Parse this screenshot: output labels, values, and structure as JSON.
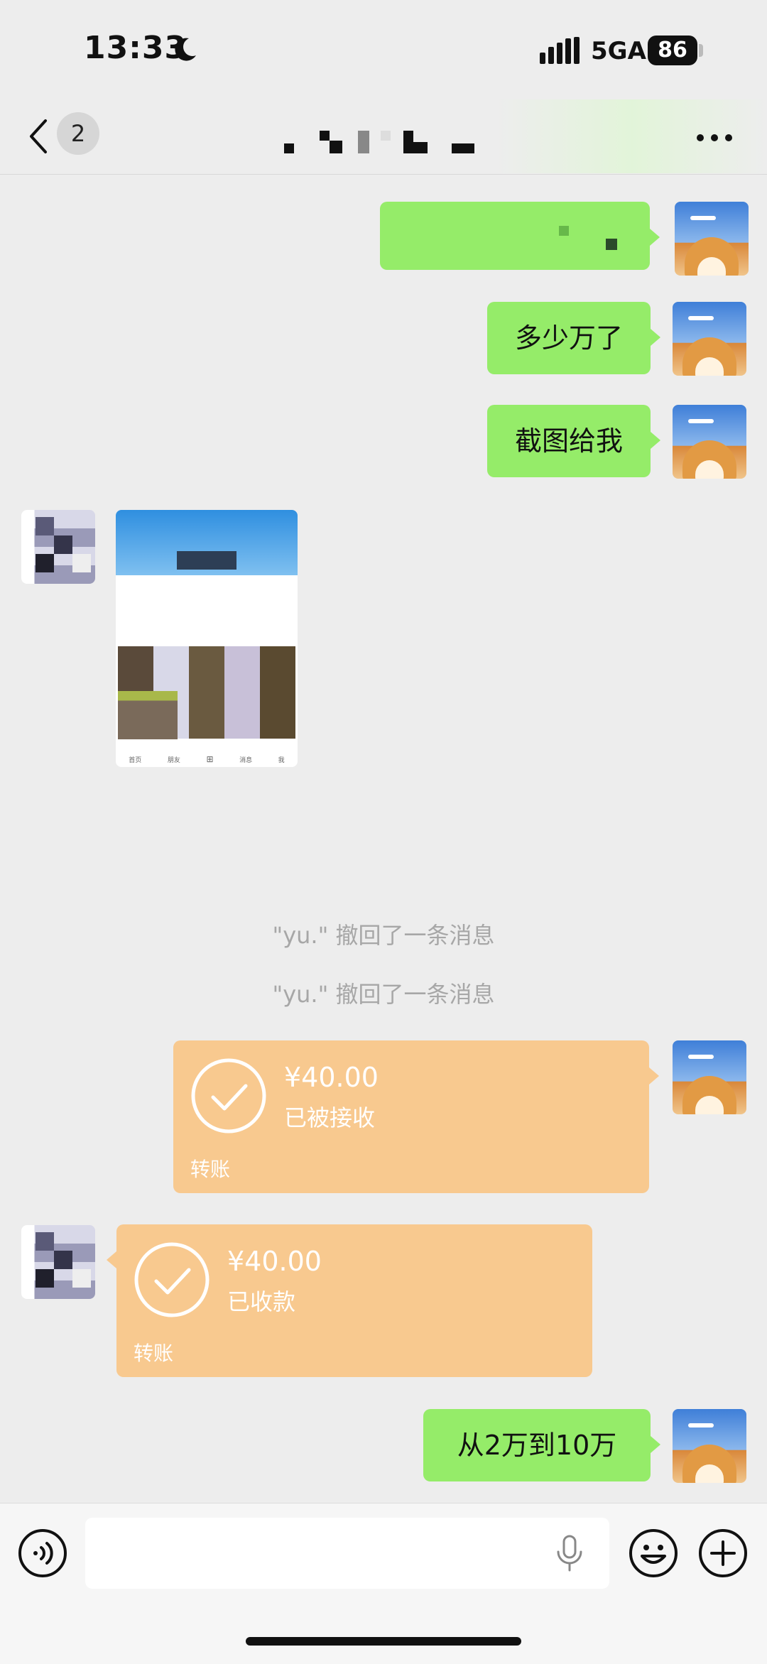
{
  "status": {
    "time": "13:33",
    "network": "5GA",
    "battery": "86"
  },
  "nav": {
    "unread_count": "2"
  },
  "messages": {
    "m2": "多少万了",
    "m3": "截图给我",
    "m8": "从2万到10万"
  },
  "image_msg": {
    "tabs": [
      "首页",
      "朋友",
      "消息",
      "我"
    ]
  },
  "system": {
    "recall_1": "\"yu.\" 撤回了一条消息",
    "recall_2": "\"yu.\" 撤回了一条消息"
  },
  "transfers": [
    {
      "amount": "¥40.00",
      "state": "已被接收",
      "kind": "转账"
    },
    {
      "amount": "¥40.00",
      "state": "已收款",
      "kind": "转账"
    }
  ],
  "input": {
    "placeholder": ""
  },
  "colors": {
    "background": "#ededed",
    "self_bubble": "#95ec69",
    "transfer": "#f8c98f",
    "system_text": "#a7a7a7"
  },
  "icons": [
    "moon-icon",
    "signal-icon",
    "back-icon",
    "more-icon",
    "check-icon",
    "voice-icon",
    "mic-icon",
    "emoji-icon",
    "plus-icon"
  ]
}
